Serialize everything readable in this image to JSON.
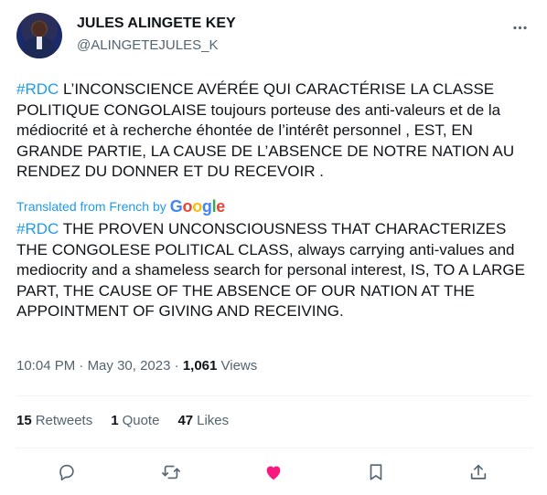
{
  "author": {
    "name": "JULES ALINGETE KEY",
    "handle": "@ALINGETEJULES_K"
  },
  "tweet": {
    "original_hashtag": "#RDC",
    "original_text": " L’INCONSCIENCE AVÉRÉE QUI CARACTÉRISE LA CLASSE POLITIQUE CONGOLAISE toujours porteuse des anti-valeurs et de la médiocrité et à recherche éhontée de l’intérêt personnel , EST, EN GRANDE PARTIE, LA CAUSE DE L’ABSENCE DE NOTRE NATION AU RENDEZ DU DONNER ET DU RECEVOIR .",
    "translated_label": "Translated from French",
    "translated_by": "by",
    "translator": "Google",
    "translated_hashtag": "#RDC",
    "translated_text": " THE PROVEN UNCONSCIOUSNESS THAT CHARACTERIZES THE CONGOLESE POLITICAL CLASS, always carrying anti-values and mediocrity and a shameless search for personal interest, IS, TO A LARGE PART, THE CAUSE OF THE ABSENCE OF OUR NATION AT THE APPOINTMENT OF GIVING AND RECEIVING."
  },
  "meta": {
    "time": "10:04 PM",
    "separator": " · ",
    "date": "May 30, 2023",
    "separator2": " · ",
    "views_count": "1,061",
    "views_label": " Views"
  },
  "stats": {
    "retweets_count": "15",
    "retweets_label": "Retweets",
    "quotes_count": "1",
    "quotes_label": "Quote",
    "likes_count": "47",
    "likes_label": "Likes"
  },
  "colors": {
    "accent": "#1d9bf0",
    "like": "#f91880",
    "muted": "#536471",
    "text": "#0f1419"
  },
  "icons": {
    "more": "more-dots-icon",
    "reply": "reply-bubble-icon",
    "retweet": "retweet-arrows-icon",
    "like": "heart-filled-icon",
    "bookmark": "bookmark-icon",
    "share": "share-upload-icon"
  }
}
